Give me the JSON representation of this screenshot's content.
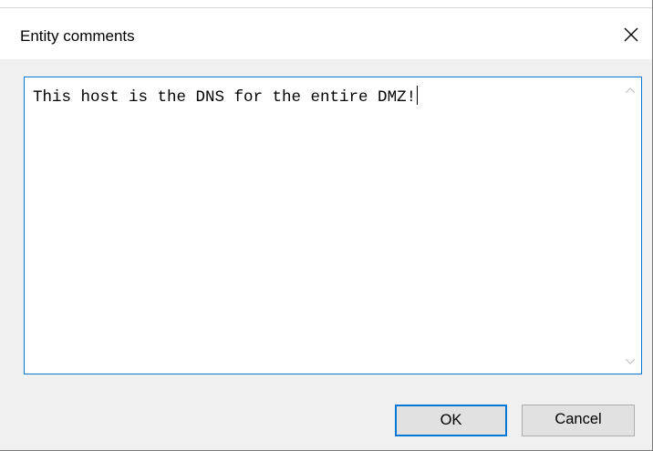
{
  "dialog": {
    "title": "Entity comments",
    "close_icon": "close-icon"
  },
  "comment": {
    "value": "This host is the DNS for the entire DMZ!",
    "scroll_up_icon": "chevron-up-icon",
    "scroll_down_icon": "chevron-down-icon"
  },
  "buttons": {
    "ok_label": "OK",
    "cancel_label": "Cancel"
  },
  "colors": {
    "focus_border": "#0078d7",
    "button_face": "#e1e1e1",
    "dialog_background": "#f0f0f0"
  }
}
